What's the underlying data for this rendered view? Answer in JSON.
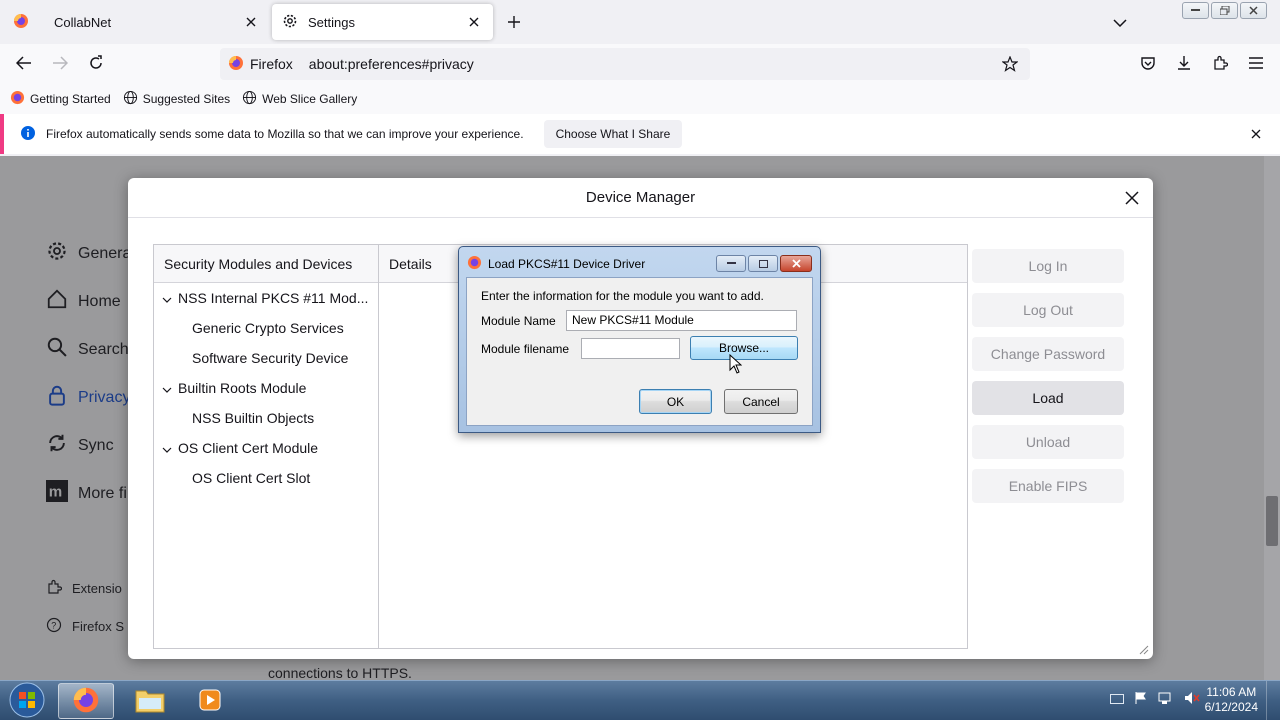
{
  "colors": {
    "accent": "#0061e0",
    "notif_border": "#ef3a83",
    "dim_overlay": "#9a9a9c"
  },
  "tabs": [
    {
      "title": "CollabNet",
      "icon": "firefox-icon"
    },
    {
      "title": "Settings",
      "icon": "gear-icon"
    }
  ],
  "navbar": {
    "identity_label": "Firefox",
    "url": "about:preferences#privacy"
  },
  "bookmarks": [
    {
      "label": "Getting Started",
      "icon": "firefox-icon"
    },
    {
      "label": "Suggested Sites",
      "icon": "globe-icon"
    },
    {
      "label": "Web Slice Gallery",
      "icon": "globe-icon"
    }
  ],
  "notification": {
    "message": "Firefox automatically sends some data to Mozilla so that we can improve your experience.",
    "button": "Choose What I Share"
  },
  "settings_sidebar": {
    "items": [
      {
        "label": "Genera",
        "icon": "gear-icon"
      },
      {
        "label": "Home",
        "icon": "home-icon"
      },
      {
        "label": "Search",
        "icon": "search-icon"
      },
      {
        "label": "Privacy",
        "icon": "lock-icon"
      },
      {
        "label": "Sync",
        "icon": "sync-icon"
      },
      {
        "label": "More fi",
        "icon": "mozilla-icon"
      }
    ],
    "footer": [
      {
        "label": "Extensio",
        "icon": "puzzle-icon"
      },
      {
        "label": "Firefox S",
        "icon": "help-icon"
      }
    ]
  },
  "page_fragment": "connections to HTTPS.",
  "device_manager": {
    "title": "Device Manager",
    "tree_header": "Security Modules and Devices",
    "details_header": "Details",
    "tree": [
      {
        "label": "NSS Internal PKCS #11 Mod...",
        "level": 0
      },
      {
        "label": "Generic Crypto Services",
        "level": 1
      },
      {
        "label": "Software Security Device",
        "level": 1
      },
      {
        "label": "Builtin Roots Module",
        "level": 0
      },
      {
        "label": "NSS Builtin Objects",
        "level": 1
      },
      {
        "label": "OS Client Cert Module",
        "level": 0
      },
      {
        "label": "OS Client Cert Slot",
        "level": 1
      }
    ],
    "buttons": {
      "login": "Log In",
      "logout": "Log Out",
      "change_password": "Change Password",
      "load": "Load",
      "unload": "Unload",
      "enable_fips": "Enable FIPS"
    }
  },
  "load_dialog": {
    "title": "Load PKCS#11 Device Driver",
    "prompt": "Enter the information for the module you want to add.",
    "module_name_label": "Module Name",
    "module_name_value": "New PKCS#11 Module",
    "module_filename_label": "Module filename",
    "module_filename_value": "",
    "browse": "Browse...",
    "ok": "OK",
    "cancel": "Cancel"
  },
  "taskbar": {
    "time": "11:06 AM",
    "date": "6/12/2024"
  }
}
